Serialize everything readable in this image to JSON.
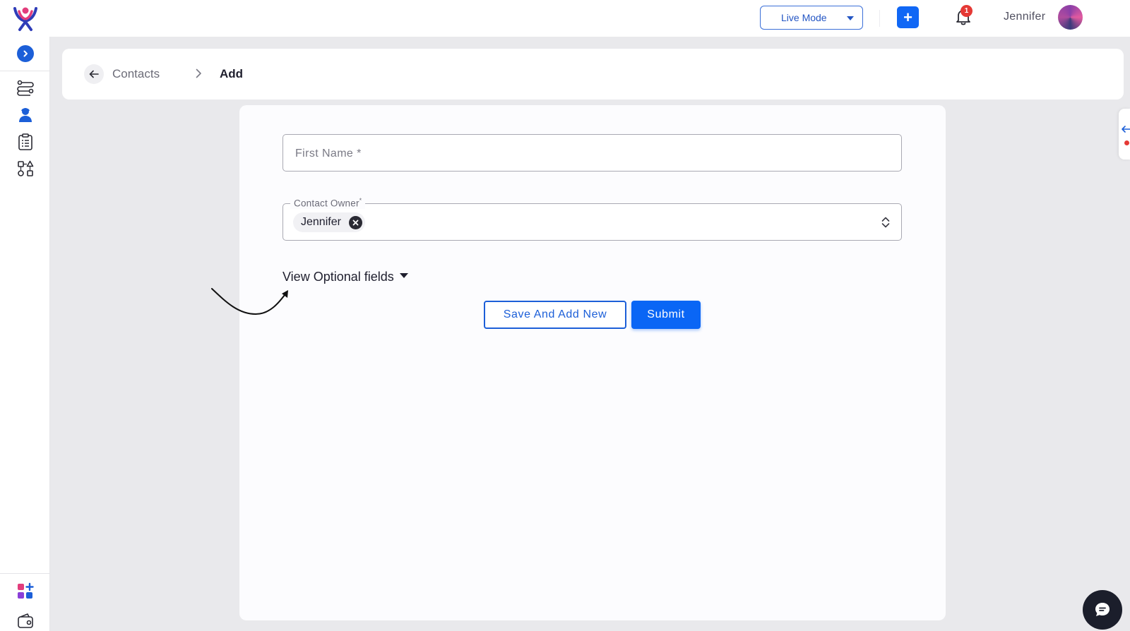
{
  "header": {
    "mode_select": {
      "value": "Live Mode"
    },
    "notifications": {
      "count": "1"
    },
    "user": {
      "name": "Jennifer"
    }
  },
  "breadcrumb": {
    "parent": "Contacts",
    "current": "Add"
  },
  "form": {
    "first_name": {
      "placeholder": "First Name *"
    },
    "contact_owner": {
      "label": "Contact Owner",
      "required_mark": "*",
      "selected": "Jennifer"
    },
    "optional_toggle": "View Optional fields",
    "buttons": {
      "save_and_add_new": "Save And Add New",
      "submit": "Submit"
    }
  },
  "colors": {
    "accent": "#1067f5",
    "badge": "#e53935",
    "chat": "#1b1e2b"
  },
  "icons": {
    "sidebar": [
      "workflow-icon",
      "contacts-icon",
      "clipboard-list-icon",
      "shapes-icon",
      "apps-add-icon",
      "wallet-icon"
    ]
  }
}
